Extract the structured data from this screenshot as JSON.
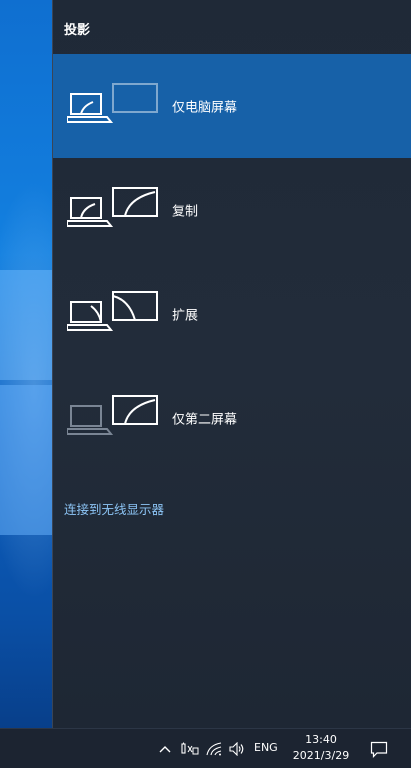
{
  "panel": {
    "title": "投影",
    "options": [
      {
        "label": "仅电脑屏幕",
        "icon": "pc-screen-only-icon",
        "selected": true
      },
      {
        "label": "复制",
        "icon": "duplicate-icon",
        "selected": false
      },
      {
        "label": "扩展",
        "icon": "extend-icon",
        "selected": false
      },
      {
        "label": "仅第二屏幕",
        "icon": "second-screen-only-icon",
        "selected": false
      }
    ],
    "connect_link": "连接到无线显示器"
  },
  "taskbar": {
    "tray_icons": [
      "chevron-up-icon",
      "network-battery-icon",
      "wifi-icon",
      "volume-icon"
    ],
    "language": "ENG",
    "time": "13:40",
    "date": "2021/3/29",
    "notification_icon": "action-center-icon"
  },
  "colors": {
    "panel_bg": "#222c3a",
    "selected_bg": "#1761a8",
    "link": "#8cc4f5",
    "taskbar_bg": "#1c2431"
  }
}
